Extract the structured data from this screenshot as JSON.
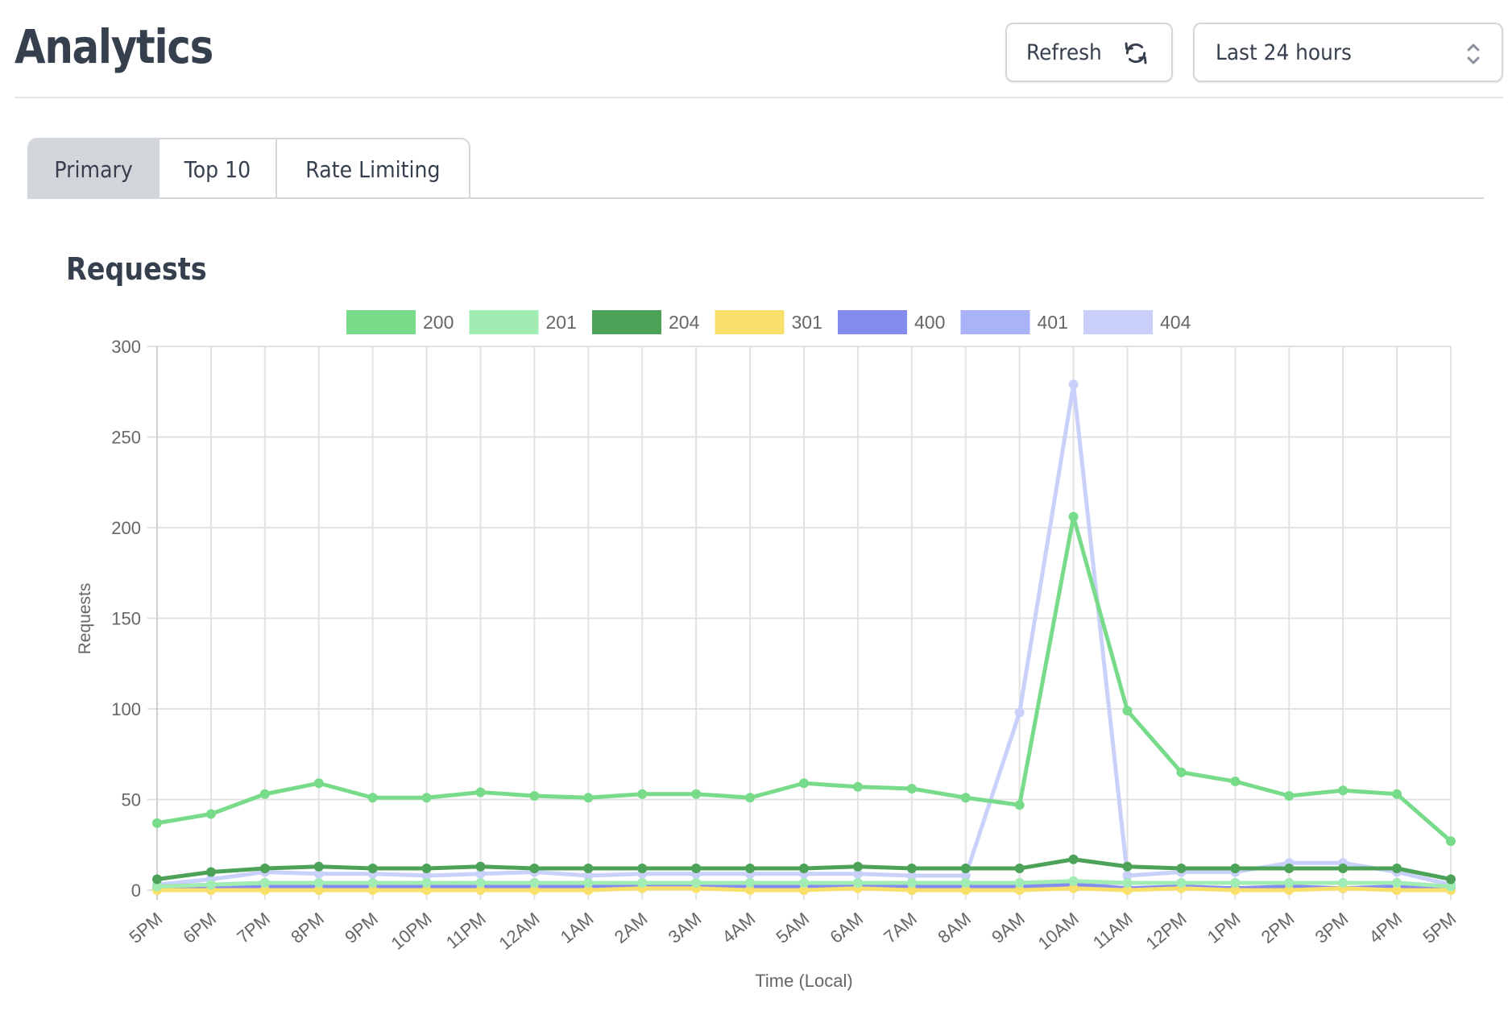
{
  "page": {
    "title": "Analytics",
    "refresh_label": "Refresh",
    "refresh_icon": "refresh-icon",
    "time_range": "Last 24 hours",
    "select_icon": "chevron-up-down-icon"
  },
  "tabs": [
    {
      "label": "Primary",
      "active": true
    },
    {
      "label": "Top 10",
      "active": false
    },
    {
      "label": "Rate Limiting",
      "active": false
    }
  ],
  "section": {
    "title": "Requests"
  },
  "colors": {
    "200": "#78db8a",
    "201": "#a0ecb3",
    "204": "#4ca357",
    "301": "#f8e06a",
    "400": "#848cf0",
    "401": "#aab2f8",
    "404": "#c9d0fa"
  },
  "chart_data": {
    "type": "line",
    "title": "",
    "xlabel": "Time (Local)",
    "ylabel": "Requests",
    "ylim": [
      0,
      300
    ],
    "yticks": [
      0,
      50,
      100,
      150,
      200,
      250,
      300
    ],
    "grid": true,
    "legend_position": "top-center",
    "x": [
      "5PM",
      "6PM",
      "7PM",
      "8PM",
      "9PM",
      "10PM",
      "11PM",
      "12AM",
      "1AM",
      "2AM",
      "3AM",
      "4AM",
      "5AM",
      "6AM",
      "7AM",
      "8AM",
      "9AM",
      "10AM",
      "11AM",
      "12PM",
      "1PM",
      "2PM",
      "3PM",
      "4PM",
      "5PM"
    ],
    "series": [
      {
        "name": "200",
        "values": [
          37,
          42,
          53,
          59,
          51,
          51,
          54,
          52,
          51,
          53,
          53,
          51,
          59,
          57,
          56,
          51,
          47,
          206,
          99,
          65,
          60,
          52,
          55,
          53,
          27
        ]
      },
      {
        "name": "201",
        "values": [
          2,
          3,
          4,
          4,
          4,
          4,
          4,
          4,
          4,
          4,
          4,
          4,
          4,
          4,
          4,
          4,
          4,
          5,
          4,
          4,
          4,
          4,
          4,
          4,
          2
        ]
      },
      {
        "name": "204",
        "values": [
          6,
          10,
          12,
          13,
          12,
          12,
          13,
          12,
          12,
          12,
          12,
          12,
          12,
          13,
          12,
          12,
          12,
          17,
          13,
          12,
          12,
          12,
          12,
          12,
          6
        ]
      },
      {
        "name": "301",
        "values": [
          0,
          0,
          0,
          0,
          0,
          0,
          0,
          0,
          0,
          1,
          1,
          0,
          0,
          1,
          0,
          0,
          0,
          1,
          0,
          1,
          0,
          0,
          1,
          0,
          0
        ]
      },
      {
        "name": "400",
        "values": [
          1,
          1,
          2,
          2,
          2,
          2,
          2,
          2,
          2,
          2,
          2,
          2,
          2,
          2,
          2,
          2,
          2,
          3,
          1,
          2,
          1,
          2,
          1,
          2,
          1
        ]
      },
      {
        "name": "401",
        "values": [
          2,
          3,
          4,
          4,
          4,
          4,
          4,
          4,
          4,
          4,
          4,
          4,
          4,
          4,
          4,
          4,
          4,
          4,
          4,
          4,
          4,
          4,
          4,
          4,
          2
        ]
      },
      {
        "name": "404",
        "values": [
          3,
          6,
          10,
          9,
          9,
          8,
          9,
          10,
          8,
          9,
          9,
          9,
          9,
          9,
          8,
          8,
          98,
          279,
          8,
          10,
          10,
          15,
          15,
          10,
          3
        ]
      }
    ]
  }
}
